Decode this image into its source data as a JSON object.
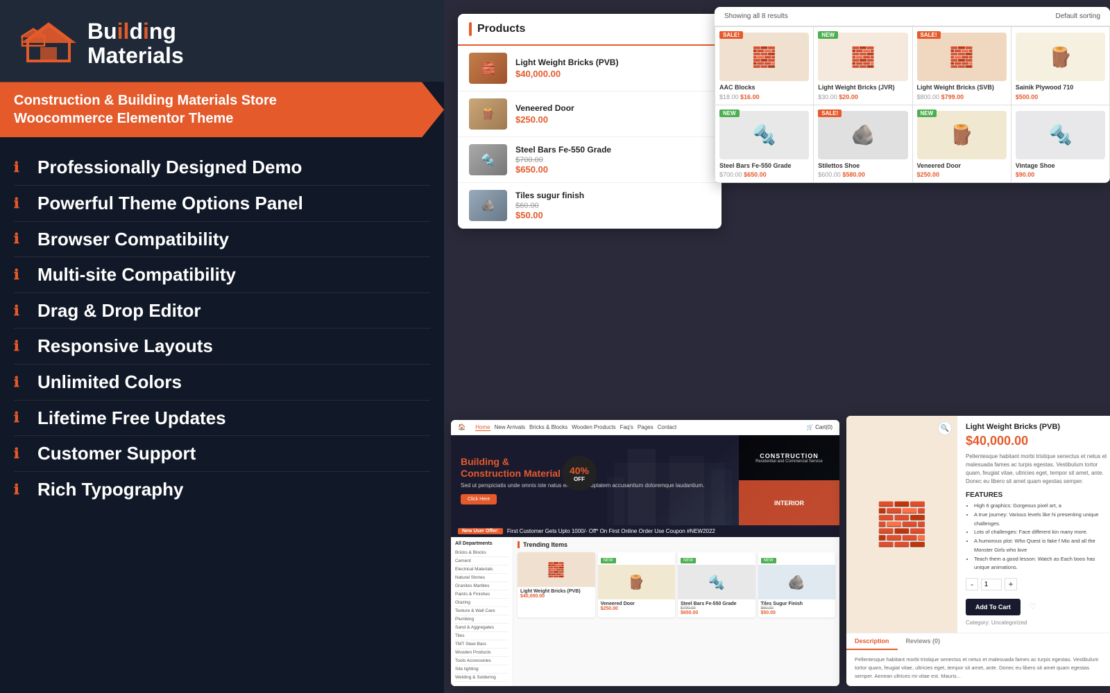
{
  "left": {
    "logo": {
      "line1": "Buildıng",
      "line2": "Materials"
    },
    "tagline": {
      "line1": "Construction & Building Materials Store",
      "line2": "Woocommerce Elementor Theme"
    },
    "features": [
      {
        "label": "Professionally Designed Demo"
      },
      {
        "label": "Powerful Theme Options Panel"
      },
      {
        "label": "Browser Compatibility"
      },
      {
        "label": "Multi-site Compatibility"
      },
      {
        "label": "Drag & Drop Editor"
      },
      {
        "label": "Responsive Layouts"
      },
      {
        "label": "Unlimited Colors"
      },
      {
        "label": "Lifetime Free Updates"
      },
      {
        "label": "Customer Support"
      },
      {
        "label": "Rich Typography"
      }
    ]
  },
  "products": {
    "title": "Products",
    "items": [
      {
        "name": "Light Weight Bricks (PVB)",
        "price": "$40,000.00",
        "type": "brick"
      },
      {
        "name": "Veneered Door",
        "price": "$250.00",
        "type": "wood"
      },
      {
        "name": "Steel Bars Fe-550 Grade",
        "old_price": "$700.00",
        "price": "$650.00",
        "type": "steel"
      },
      {
        "name": "Tiles sugur finish",
        "old_price": "$60.00",
        "price": "$50.00",
        "type": "tile"
      }
    ]
  },
  "shop": {
    "header": "Showing all 8 results",
    "sort": "Default sorting",
    "items": [
      {
        "name": "AAC Blocks",
        "old": "$18.00",
        "new": "$16.00",
        "badge": "SALE",
        "type": "brick-img"
      },
      {
        "name": "Light Weight Bricks (JVR)",
        "old": "$30.00",
        "new": "$20.00",
        "badge": "NEW",
        "type": "brick2-img"
      },
      {
        "name": "Light Weight Bricks (SVB)",
        "old": "$800.00",
        "new": "$799.00",
        "badge": "SALE",
        "type": "brick3-img"
      },
      {
        "name": "Sainik Plywood 710",
        "new": "$500.00",
        "type": "wood-img"
      },
      {
        "name": "Steel Bars Fe-550 Grade",
        "old": "$700.00",
        "new": "$650.00",
        "badge": "NEW",
        "type": "wire-img"
      },
      {
        "name": "Stilettos Shoe",
        "old": "$600.00",
        "new": "$580.00",
        "badge": "SALE",
        "type": "stone-img"
      },
      {
        "name": "Veneered Door",
        "new": "$250.00",
        "badge": "NEW",
        "type": "planks-img"
      },
      {
        "name": "Vintage Shoe",
        "new": "$90.00",
        "type": "nails-img"
      }
    ]
  },
  "website": {
    "nav": {
      "logo": "Building Materials",
      "links": [
        "Home",
        "New Arrivals",
        "Bricks & Blocks",
        "Wooden Products",
        "Faq's",
        "Pages",
        "Contact"
      ]
    },
    "hero": {
      "title_line1": "Building &",
      "title_line2": "Construction Material",
      "subtitle": "Sed ut perspiciatis unde omnis iste natus error sit voluptatem accusantium doloremque laudantium.",
      "button": "Click Here",
      "discount_pct": "40%",
      "discount_label": "OFF",
      "construction_label": "CONSTRUCTION",
      "construction_sub": "Residential and Commercial Service",
      "interior_label": "INTERIOR"
    },
    "offer": "First Customer Gets Upto 1000/- Off* On First Online Order Use Coupon #NEW2022",
    "offer_label": "New User Offer:",
    "sidebar_title": "All Departments",
    "sidebar_items": [
      "Bricks & Blocks",
      "Cement",
      "Electrical Materials",
      "Natural Stones",
      "Granites Marbles",
      "Paints & Finishes",
      "Glazing",
      "Texture & Wall Care",
      "Plumbing",
      "Sand & Aggregates",
      "Tiles",
      "TMT Steel Bars",
      "Wooden Products",
      "Tools Accessories",
      "Site lighting",
      "Welding & Soldering"
    ],
    "trending_title": "Trending Items",
    "trending_items": [
      {
        "name": "Light Weight Bricks (PVB)",
        "price": "$40,000.00",
        "badge": "",
        "type": "brick-trend"
      },
      {
        "name": "Veneered Door",
        "price": "$250.00",
        "badge": "NEW",
        "type": "wood-trend"
      },
      {
        "name": "Steel Bars Fe-550 Grade",
        "old": "$700.00",
        "price": "$650.00",
        "badge": "NEW",
        "type": "steel-trend"
      },
      {
        "name": "Tiles Sugur Finish",
        "old": "$60.00",
        "price": "$50.00",
        "badge": "NEW",
        "type": "tile-trend"
      }
    ]
  },
  "detail": {
    "title": "Light Weight Bricks (PVB)",
    "price": "$40,000.00",
    "desc": "Pellentesque habitant morbi tristique senectus et netus et malesuada fames ac turpis egestas. Vestibulum tortor quam, feugiat vitae, ultricies eget, tempor sit amet, ante. Donec eu libero sit amet quam egestas semper.",
    "features_title": "FEATURES",
    "features": [
      "High 6 graphics: Gorgeous pixel art, a",
      "A true journey: Various levels like hi presenting unique challenges.",
      "Lots of challenges: Face different kin many more.",
      "A humorous plot: Who Quest is fake f Mio and all the Monster Girls who love",
      "Teach them a good lesson: Watch as Each boos has unique animations."
    ],
    "qty": "1",
    "add_to_cart": "Add To Cart",
    "category": "Category: Uncategorized",
    "tab_desc": "Description",
    "tab_reviews": "Reviews (0)",
    "bottom_text": "Pellentesque habitant morbi tristique senectus et netus et malesuada fames ac turpis egestas. Vestibulum tortor quam, feugiat vitae, ultricies eget, tempor sit amet, ante. Donec eu libero sit amet quam egestas semper. Aenean ultrices mi vitae est. Mauris..."
  }
}
